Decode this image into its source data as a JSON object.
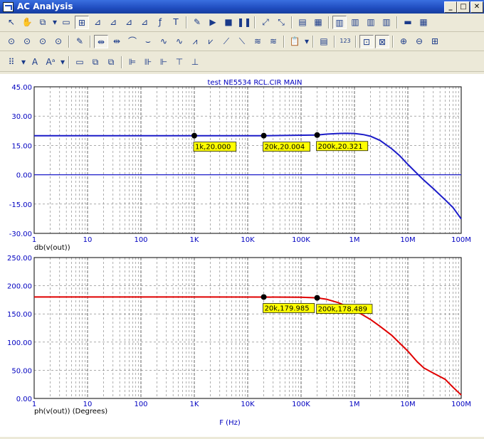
{
  "window": {
    "title": "AC Analysis"
  },
  "controls": {
    "minimize": "_",
    "maximize": "□",
    "close": "✕"
  },
  "colors": {
    "top_trace": "#1c1cc8",
    "bottom_trace": "#e00000",
    "axis_text": "#0000c0",
    "grid": "#7a7a7a",
    "marker_bg": "#ffff00"
  },
  "toolbars": [
    [
      {
        "name": "select-icon",
        "glyph": "↖"
      },
      {
        "name": "pan-hand-icon",
        "glyph": "✋"
      },
      {
        "name": "copy-icon",
        "glyph": "⧉"
      },
      {
        "name": "dropdown-arrow-icon",
        "glyph": "▾"
      },
      {
        "name": "window-icon",
        "glyph": "▭"
      },
      {
        "name": "scale-icon",
        "glyph": "⊞",
        "pressed": true
      },
      {
        "name": "graph-icon",
        "glyph": "⊿"
      },
      {
        "name": "graph-edit-icon",
        "glyph": "⊿"
      },
      {
        "name": "graph-flip-icon",
        "glyph": "⊿"
      },
      {
        "name": "graph-down-icon",
        "glyph": "⊿"
      },
      {
        "name": "function-icon",
        "glyph": "ƒ"
      },
      {
        "name": "text-icon",
        "glyph": "T"
      },
      {
        "name": "sep"
      },
      {
        "name": "properties-icon",
        "glyph": "✎"
      },
      {
        "name": "run-icon",
        "glyph": "▶"
      },
      {
        "name": "stop-icon",
        "glyph": "■"
      },
      {
        "name": "pause-icon",
        "glyph": "❚❚"
      },
      {
        "name": "sep"
      },
      {
        "name": "add-curve-icon",
        "glyph": "⤢"
      },
      {
        "name": "delete-curve-icon",
        "glyph": "⤡"
      },
      {
        "name": "sep"
      },
      {
        "name": "table-icon",
        "glyph": "▤"
      },
      {
        "name": "grid-icon",
        "glyph": "▦"
      },
      {
        "name": "sep"
      },
      {
        "name": "layout-1-icon",
        "glyph": "▥",
        "pressed": true
      },
      {
        "name": "layout-2-icon",
        "glyph": "▥"
      },
      {
        "name": "layout-3-icon",
        "glyph": "▥"
      },
      {
        "name": "layout-4-icon",
        "glyph": "▥"
      },
      {
        "name": "sep"
      },
      {
        "name": "stack-h-icon",
        "glyph": "▬"
      },
      {
        "name": "stack-grid-icon",
        "glyph": "▦"
      }
    ],
    [
      {
        "name": "cursor-mode-1-icon",
        "glyph": "⊙"
      },
      {
        "name": "cursor-mode-2-icon",
        "glyph": "⊙"
      },
      {
        "name": "cursor-mode-3-icon",
        "glyph": "⊙"
      },
      {
        "name": "cursor-mode-4-icon",
        "glyph": "⊙"
      },
      {
        "name": "sep"
      },
      {
        "name": "label-icon",
        "glyph": "✎"
      },
      {
        "name": "sep"
      },
      {
        "name": "peak-icon",
        "glyph": "⇹",
        "pressed": true
      },
      {
        "name": "valley-icon",
        "glyph": "⇹"
      },
      {
        "name": "high-icon",
        "glyph": "⌒"
      },
      {
        "name": "low-icon",
        "glyph": "⌣"
      },
      {
        "name": "inflection-icon",
        "glyph": "∿"
      },
      {
        "name": "slope-icon",
        "glyph": "∿"
      },
      {
        "name": "global-high-icon",
        "glyph": "⩘"
      },
      {
        "name": "global-low-icon",
        "glyph": "⩗"
      },
      {
        "name": "top-icon",
        "glyph": "⟋"
      },
      {
        "name": "bottom-icon",
        "glyph": "⟍"
      },
      {
        "name": "peak-list-icon",
        "glyph": "≋"
      },
      {
        "name": "valley-list-icon",
        "glyph": "≋"
      },
      {
        "name": "sep"
      },
      {
        "name": "clipboard-icon",
        "glyph": "📋"
      },
      {
        "name": "dropdown-arrow-icon",
        "glyph": "▾"
      },
      {
        "name": "sep"
      },
      {
        "name": "notes-icon",
        "glyph": "▤"
      },
      {
        "name": "sep"
      },
      {
        "name": "numeric-icon",
        "glyph": "123"
      },
      {
        "name": "sep"
      },
      {
        "name": "fit-icon",
        "glyph": "⊡",
        "pressed": true
      },
      {
        "name": "fit-all-icon",
        "glyph": "⊠",
        "pressed": true
      },
      {
        "name": "sep"
      },
      {
        "name": "zoom-in-icon",
        "glyph": "⊕"
      },
      {
        "name": "zoom-out-icon",
        "glyph": "⊖"
      },
      {
        "name": "zoom-region-icon",
        "glyph": "⊞"
      }
    ],
    [
      {
        "name": "grid-dots-icon",
        "glyph": "⠿"
      },
      {
        "name": "dropdown-arrow-icon",
        "glyph": "▾"
      },
      {
        "name": "font-icon",
        "glyph": "A"
      },
      {
        "name": "font-size-icon",
        "glyph": "Aᵃ"
      },
      {
        "name": "dropdown-arrow-icon",
        "glyph": "▾"
      },
      {
        "name": "sep"
      },
      {
        "name": "bring-front-icon",
        "glyph": "▭"
      },
      {
        "name": "group-icon",
        "glyph": "⧉"
      },
      {
        "name": "ungroup-icon",
        "glyph": "⧉"
      },
      {
        "name": "sep"
      },
      {
        "name": "align-left-icon",
        "glyph": "⊫"
      },
      {
        "name": "align-center-icon",
        "glyph": "⊪"
      },
      {
        "name": "align-right-icon",
        "glyph": "⊩"
      },
      {
        "name": "align-top-icon",
        "glyph": "⊤"
      },
      {
        "name": "align-bottom-icon",
        "glyph": "⊥"
      }
    ]
  ],
  "chart_data": [
    {
      "type": "line",
      "title": "test NE5534 RCL.CIR MAIN",
      "xlabel": "",
      "ylabel": "db(v(out))",
      "xscale": "log",
      "xlim": [
        1,
        100000000
      ],
      "ylim": [
        -30,
        45
      ],
      "yticks": [
        "45.00",
        "30.00",
        "15.00",
        "0.00",
        "-15.00",
        "-30.00"
      ],
      "xticks": [
        "1",
        "10",
        "100",
        "1K",
        "10K",
        "100K",
        "1M",
        "10M",
        "100M"
      ],
      "grid": true,
      "series": [
        {
          "name": "db(v(out))",
          "x": [
            1,
            1000,
            20000,
            200000,
            300000,
            500000,
            700000,
            1000000,
            1500000,
            2000000,
            3000000,
            5000000,
            7000000,
            10000000,
            15000000,
            20000000,
            30000000,
            50000000,
            70000000,
            100000000
          ],
          "y": [
            20.0,
            20.0,
            20.004,
            20.321,
            20.8,
            21.1,
            21.2,
            21.1,
            20.5,
            19.7,
            17.6,
            13.3,
            9.8,
            5.3,
            0.5,
            -2.8,
            -7.1,
            -12.8,
            -16.8,
            -22.6
          ]
        }
      ],
      "markers": [
        {
          "x": 1000,
          "y": 20.0,
          "label": "1k,20.000"
        },
        {
          "x": 20000,
          "y": 20.004,
          "label": "20k,20.004"
        },
        {
          "x": 200000,
          "y": 20.321,
          "label": "200k,20.321"
        }
      ],
      "hline": 0
    },
    {
      "type": "line",
      "title": "",
      "xlabel": "F (Hz)",
      "ylabel": "ph(v(out)) (Degrees)",
      "xscale": "log",
      "xlim": [
        1,
        100000000
      ],
      "ylim": [
        0,
        250
      ],
      "yticks": [
        "250.00",
        "200.00",
        "150.00",
        "100.00",
        "50.00",
        "0.00"
      ],
      "xticks": [
        "1",
        "10",
        "100",
        "1K",
        "10K",
        "100K",
        "1M",
        "10M",
        "100M"
      ],
      "grid": true,
      "series": [
        {
          "name": "ph(v(out))",
          "x": [
            1,
            1000,
            20000,
            100000,
            200000,
            300000,
            500000,
            700000,
            1000000,
            2000000,
            3000000,
            5000000,
            10000000,
            15000000,
            20000000,
            30000000,
            50000000,
            70000000,
            100000000
          ],
          "y": [
            180,
            180,
            179.985,
            179.5,
            178.489,
            176,
            170,
            164,
            157,
            140,
            128,
            112,
            84,
            65,
            54,
            45,
            34,
            20,
            6
          ]
        }
      ],
      "markers": [
        {
          "x": 20000,
          "y": 179.985,
          "label": "20k,179.985"
        },
        {
          "x": 200000,
          "y": 178.489,
          "label": "200k,178.489"
        }
      ]
    }
  ]
}
